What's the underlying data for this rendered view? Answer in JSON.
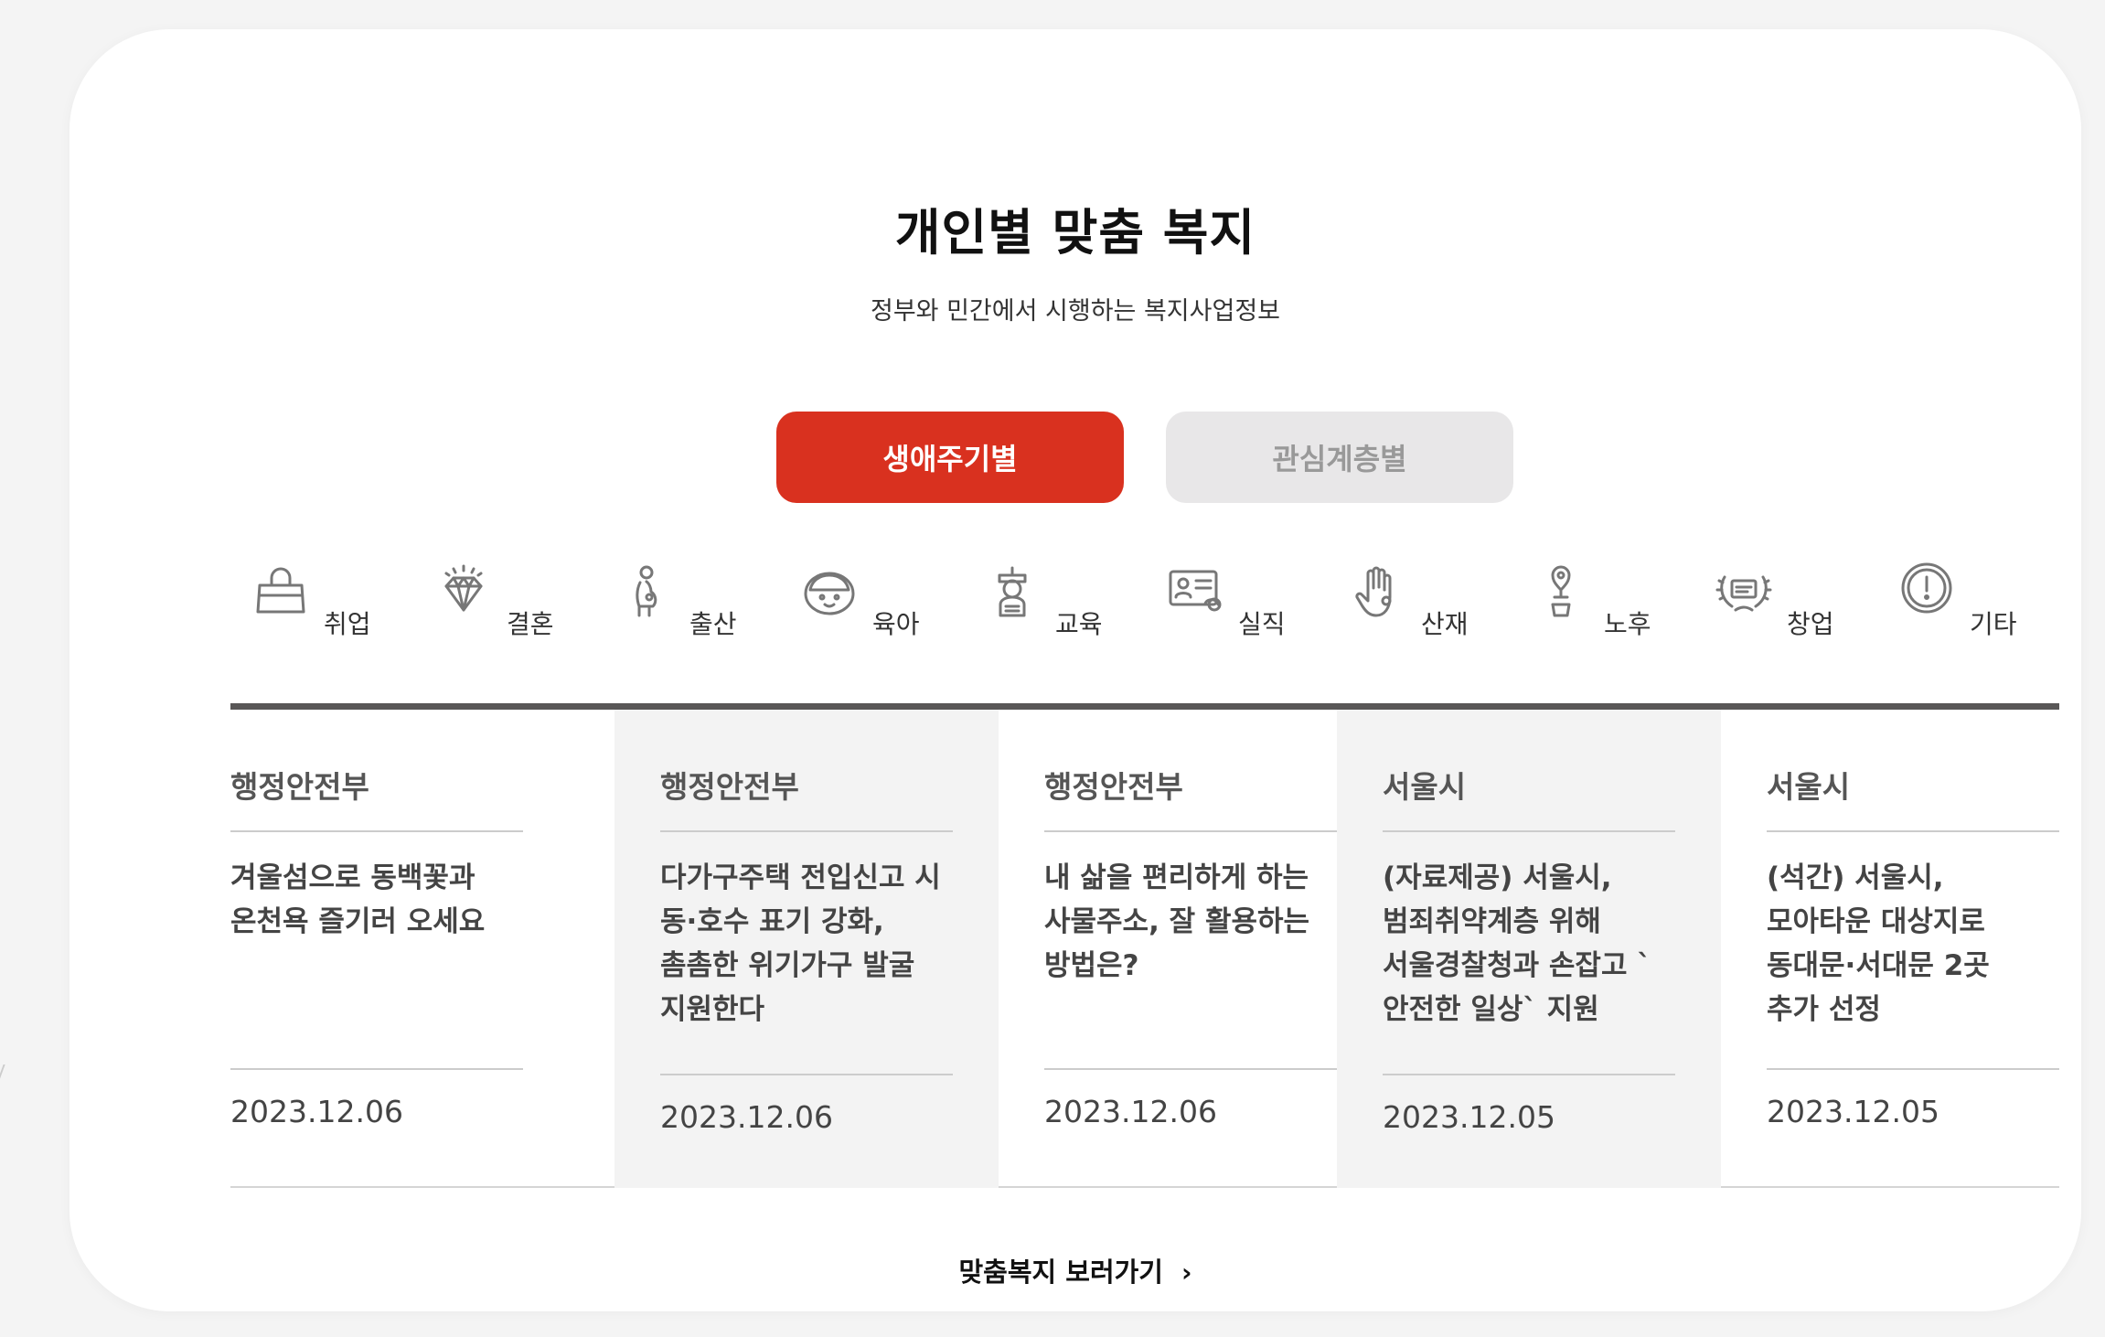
{
  "section": {
    "title": "개인별 맞춤 복지",
    "subtitle": "정부와 민간에서 시행하는 복지사업정보"
  },
  "tabs": [
    {
      "label": "생애주기별",
      "active": true
    },
    {
      "label": "관심계층별",
      "active": false
    }
  ],
  "categories": [
    {
      "label": "취업",
      "icon": "handbag-icon"
    },
    {
      "label": "결혼",
      "icon": "diamond-icon"
    },
    {
      "label": "출산",
      "icon": "pregnant-person-icon"
    },
    {
      "label": "육아",
      "icon": "baby-face-icon"
    },
    {
      "label": "교육",
      "icon": "student-icon"
    },
    {
      "label": "실직",
      "icon": "id-card-icon"
    },
    {
      "label": "산재",
      "icon": "hand-icon"
    },
    {
      "label": "노후",
      "icon": "location-person-icon"
    },
    {
      "label": "창업",
      "icon": "laurel-certificate-icon"
    },
    {
      "label": "기타",
      "icon": "exclamation-circle-icon"
    }
  ],
  "news": [
    {
      "source": "행정안전부",
      "title": "겨울섬으로 동백꽃과 온천욕 즐기러 오세요",
      "date": "2023.12.06"
    },
    {
      "source": "행정안전부",
      "title": "다가구주택 전입신고 시 동·호수 표기 강화, 촘촘한 위기가구 발굴 지원한다",
      "date": "2023.12.06"
    },
    {
      "source": "행정안전부",
      "title": "내 삶을 편리하게 하는 사물주소, 잘 활용하는 방법은?",
      "date": "2023.12.06"
    },
    {
      "source": "서울시",
      "title": "(자료제공) 서울시, 범죄취약계층 위해 서울경찰청과 손잡고 `안전한 일상` 지원",
      "date": "2023.12.05"
    },
    {
      "source": "서울시",
      "title": "(석간) 서울시, 모아타운 대상지로 동대문·서대문 2곳 추가 선정",
      "date": "2023.12.05"
    }
  ],
  "more_link": {
    "label": "맞춤복지 보러가기",
    "icon": "chevron-right-icon"
  },
  "colors": {
    "accent": "#d9311f",
    "tab_inactive": "#e8e7e8",
    "shade": "#f3f3f3"
  }
}
